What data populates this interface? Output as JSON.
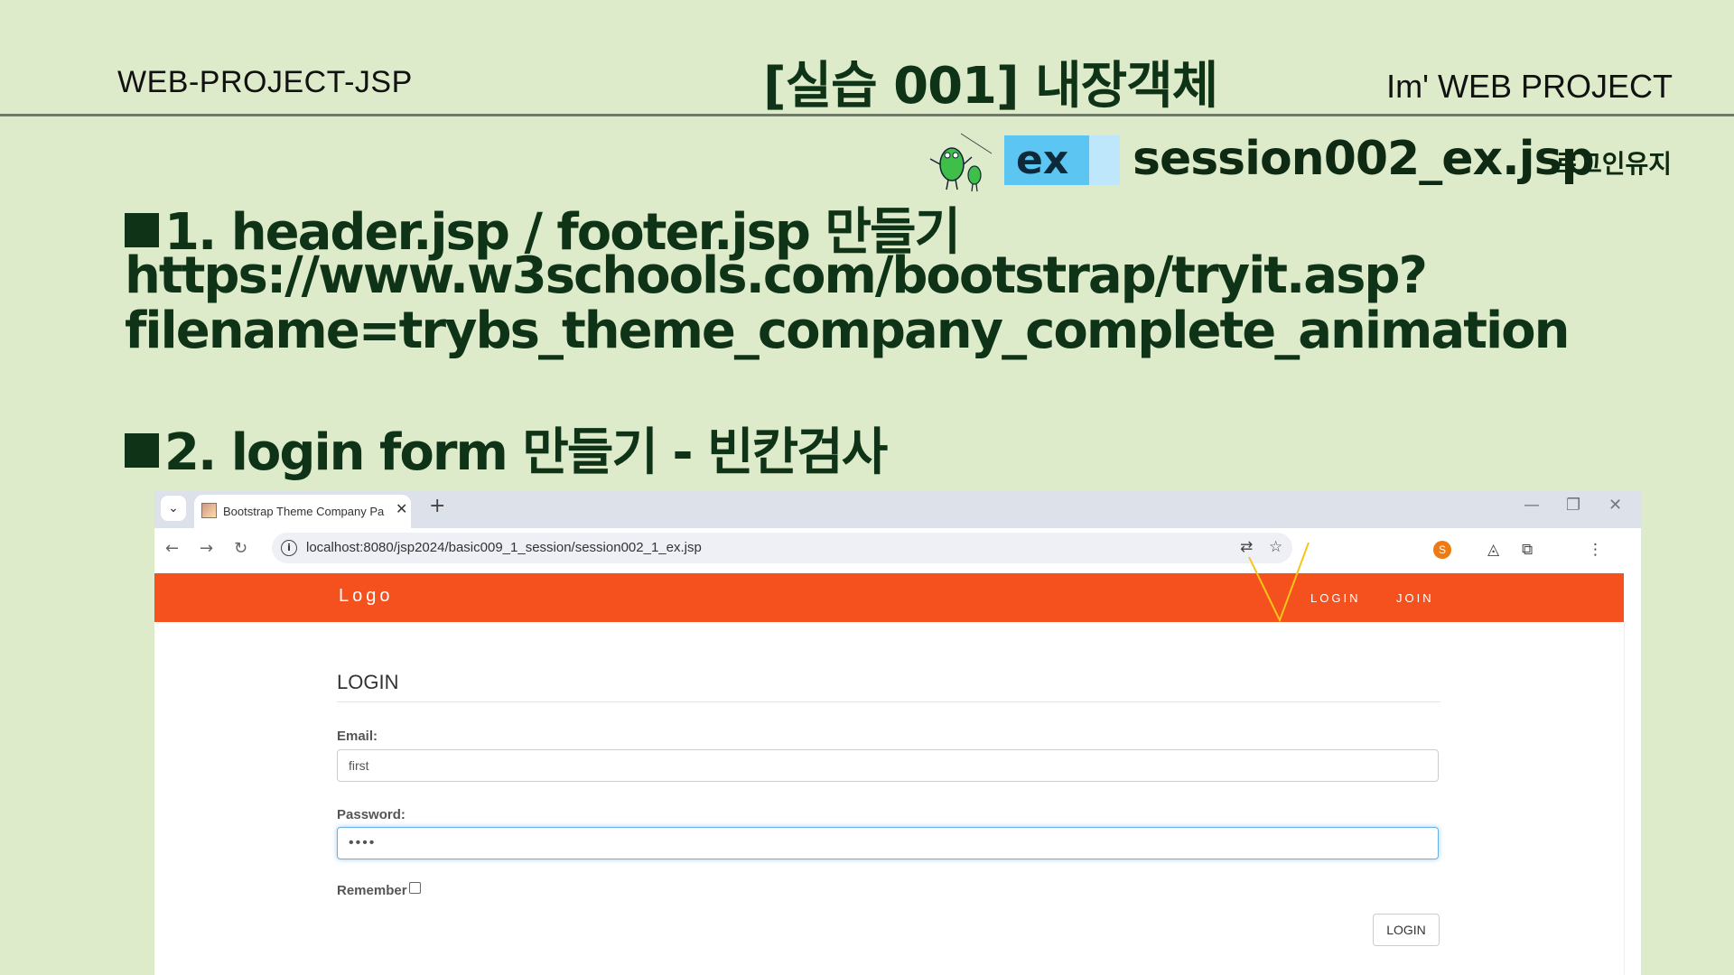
{
  "slide": {
    "header_left": "WEB-PROJECT-JSP",
    "header_title": "[실습 001] 내장객체",
    "header_right": "Im' WEB PROJECT",
    "ex_label": "ex",
    "ex_filename": "session002_ex.jsp",
    "ex_note": "로그인유지",
    "task1_line1": "1. header.jsp / footer.jsp 만들기",
    "task1_line2": "https://www.w3schools.com/bootstrap/tryit.asp?",
    "task1_line3": "filename=trybs_theme_company_complete_animation",
    "task2": "2. login form 만들기 - 빈칸검사"
  },
  "browser": {
    "tab_title": "Bootstrap Theme Company Pa",
    "url": "localhost:8080/jsp2024/basic009_1_session/session002_1_ex.jsp",
    "profile_initial": "S"
  },
  "site": {
    "brand_color": "#f4511e",
    "logo": "Logo",
    "nav": [
      "LOGIN",
      "JOIN"
    ],
    "login_title": "LOGIN",
    "email_label": "Email:",
    "email_value": "first",
    "password_label": "Password:",
    "password_value": "••••",
    "remember_label": "Remember",
    "submit_label": "LOGIN"
  }
}
